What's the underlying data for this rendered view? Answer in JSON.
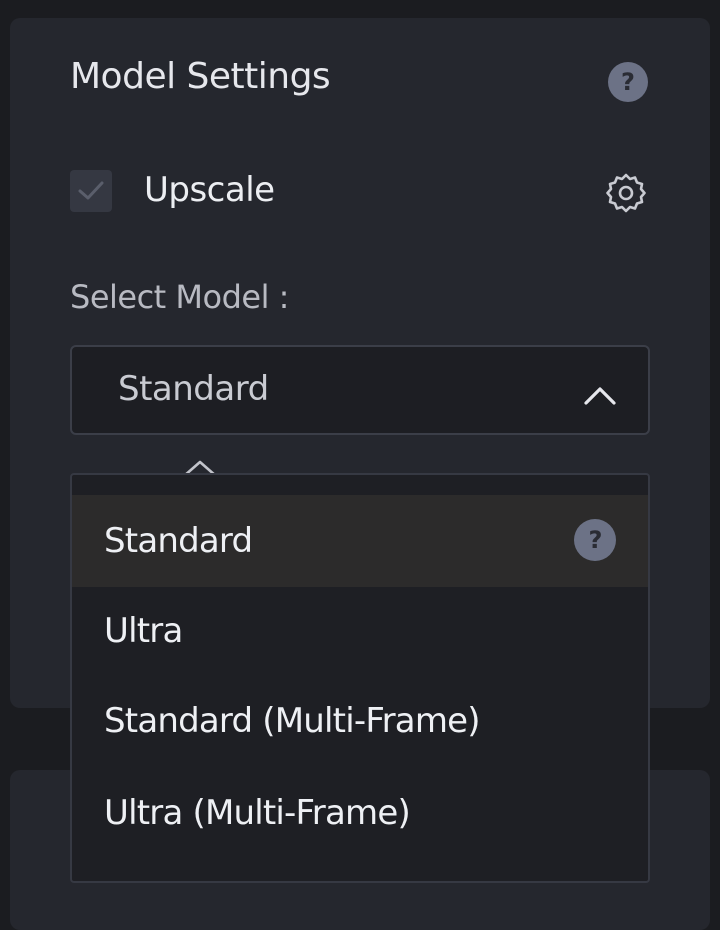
{
  "panel": {
    "title": "Model Settings",
    "help_icon": "question-circle-icon"
  },
  "upscale": {
    "label": "Upscale",
    "checked": true,
    "settings_icon": "gear-icon"
  },
  "model_select": {
    "label": "Select Model :",
    "value": "Standard",
    "chevron_icon": "chevron-up-icon",
    "options": [
      {
        "label": "Standard",
        "selected": true,
        "help_icon": "question-circle-icon"
      },
      {
        "label": "Ultra",
        "selected": false
      },
      {
        "label": "Standard (Multi-Frame)",
        "selected": false
      },
      {
        "label": "Ultra (Multi-Frame)",
        "selected": false
      }
    ]
  },
  "colors": {
    "background": "#1b1c20",
    "panel": "#25272e",
    "dropdown": "#1e1f24",
    "selected_option": "#2c2b2b",
    "help_icon": "#6c7286"
  }
}
